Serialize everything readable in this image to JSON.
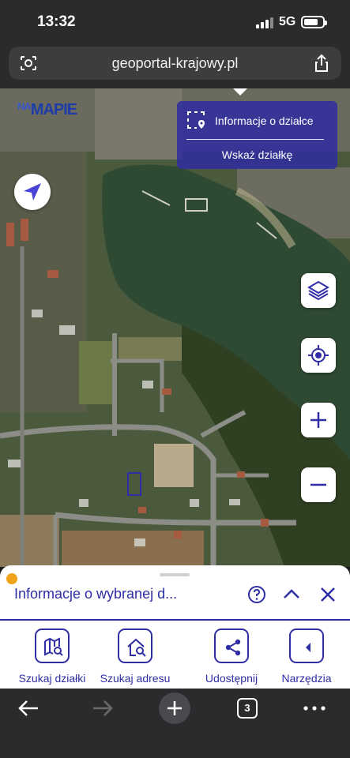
{
  "status_bar": {
    "time": "13:32",
    "network": "5G",
    "battery_level": 0.75
  },
  "browser": {
    "url": "geoportal-krajowy.pl",
    "tab_count": "3"
  },
  "map": {
    "logo_text": "NA MAPIE",
    "logo_small": "NA",
    "logo_main": "MAPIE",
    "info_panel": {
      "title": "Informacje o działce",
      "action": "Wskaż działkę"
    },
    "controls": [
      "layers-icon",
      "locate-icon",
      "zoom-in-icon",
      "zoom-out-icon"
    ]
  },
  "sheet": {
    "title": "Informacje o wybranej d..."
  },
  "toolbar": {
    "items": [
      {
        "label": "Szukaj działki",
        "icon": "map-search-icon"
      },
      {
        "label": "Szukaj adresu",
        "icon": "home-search-icon"
      },
      {
        "label": "Udostępnij",
        "icon": "share-icon"
      },
      {
        "label": "Narzędzia",
        "icon": "tools-icon"
      }
    ]
  },
  "colors": {
    "brand": "#2f2ea4",
    "accent_dot": "#f0a21b",
    "panel": "#2e2ca0"
  }
}
